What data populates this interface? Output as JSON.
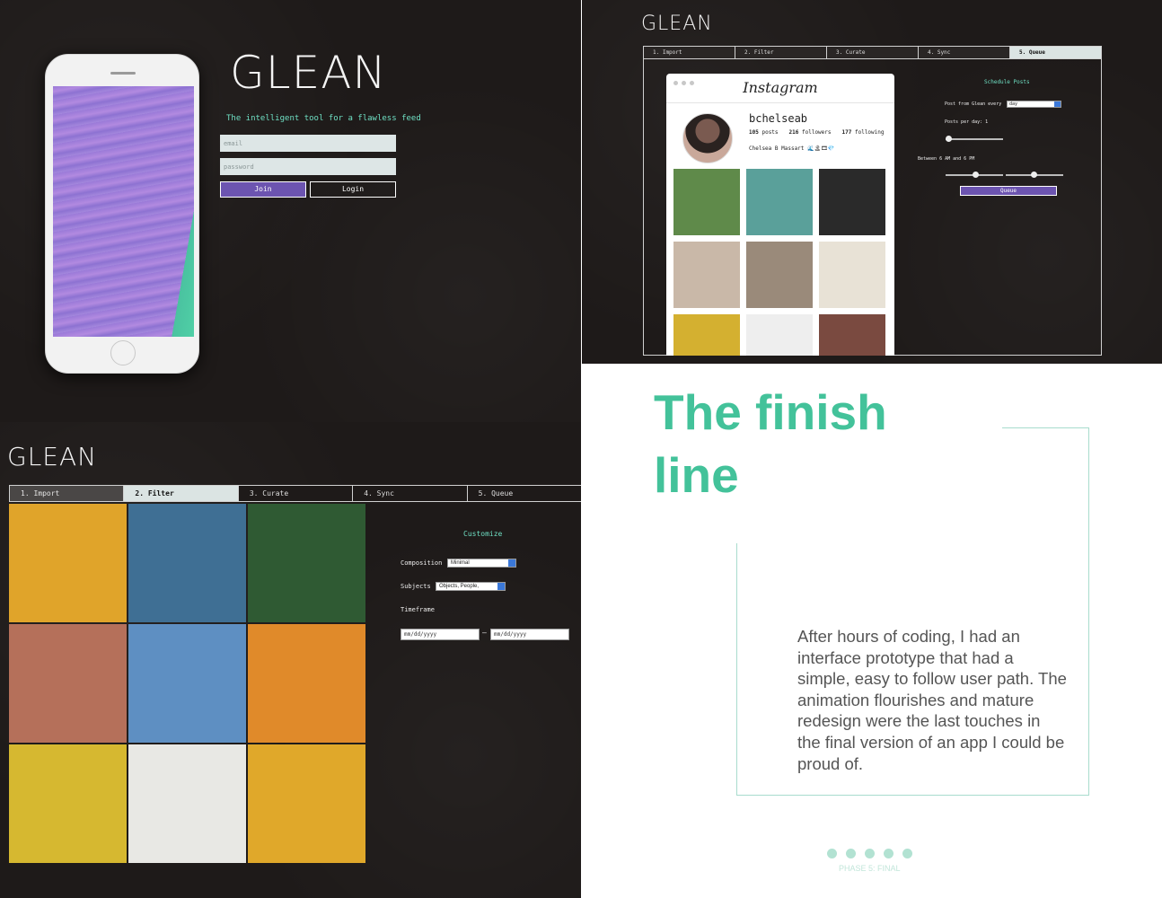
{
  "brand": "GLEAN",
  "login": {
    "tagline": "The intelligent tool for a flawless feed",
    "email_placeholder": "email",
    "password_placeholder": "password",
    "join_label": "Join",
    "login_label": "Login"
  },
  "queue_screen": {
    "tabs": [
      "1. Import",
      "2. Filter",
      "3. Curate",
      "4. Sync",
      "5. Queue"
    ],
    "active_tab": "5. Queue",
    "instagram": {
      "logo": "Instagram",
      "username": "bchelseab",
      "posts": "105",
      "posts_label": "posts",
      "followers": "216",
      "followers_label": "followers",
      "following": "177",
      "following_label": "following",
      "name": "Chelsea B Massart 🌊🏝🎞💎",
      "thumb_colors": [
        "#5f8a4a",
        "#5aa09a",
        "#2a2a2a",
        "#c9b8a8",
        "#9a8a7a",
        "#e8e2d6",
        "#d4b030",
        "#eeeeee",
        "#7a4a40"
      ]
    },
    "schedule": {
      "title": "Schedule Posts",
      "post_every_label": "Post from Glean every",
      "post_every_value": "day",
      "posts_per_day_label": "Posts per day: 1",
      "posts_per_day": 1,
      "between_label": "Between 6 AM and 6 PM",
      "queue_label": "Queue"
    }
  },
  "filter_screen": {
    "tabs": [
      "1. Import",
      "2. Filter",
      "3. Curate",
      "4. Sync",
      "5. Queue"
    ],
    "active_tab": "2. Filter",
    "photo_colors": [
      "#e0a42a",
      "#3f6f94",
      "#2f5a33",
      "#b5705a",
      "#5e8fc2",
      "#e08a2a",
      "#d6b830",
      "#e8e8e4",
      "#e0a82a"
    ],
    "customize_title": "Customize",
    "composition_label": "Composition",
    "composition_value": "Minimal",
    "subjects_label": "Subjects",
    "subjects_value": "Objects, People,",
    "timeframe_label": "Timeframe",
    "date_from_placeholder": "mm/dd/yyyy",
    "date_to_placeholder": "mm/dd/yyyy",
    "date_separator": "–"
  },
  "text_panel": {
    "title_line1": "The finish",
    "title_line2": "line",
    "body": "After hours of coding, I had an interface prototype that had a simple, easy to follow user path. The animation flourishes and mature redesign were the last touches in the final version of an app I could be proud of.",
    "phase_label": "PHASE 5: FINAL",
    "accent_color": "#43c29a"
  }
}
